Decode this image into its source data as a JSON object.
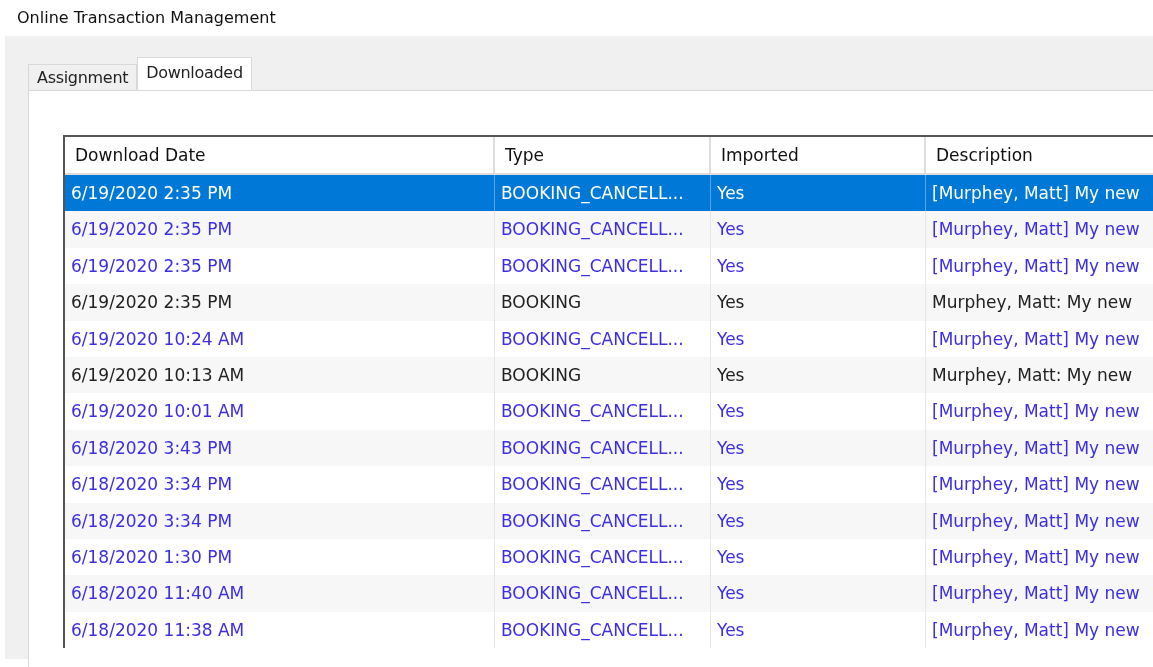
{
  "window": {
    "title": "Online Transaction Management"
  },
  "tabs": [
    {
      "label": "Assignment",
      "selected": false
    },
    {
      "label": "Downloaded",
      "selected": true
    }
  ],
  "table": {
    "columns": [
      "Download Date",
      "Type",
      "Imported",
      "Description"
    ],
    "rows": [
      {
        "kind": "cancellation",
        "selected": true,
        "cells": [
          "6/19/2020 2:35 PM",
          "BOOKING_CANCELL...",
          "Yes",
          "[Murphey, Matt] My new"
        ]
      },
      {
        "kind": "cancellation",
        "selected": false,
        "cells": [
          "6/19/2020 2:35 PM",
          "BOOKING_CANCELL...",
          "Yes",
          "[Murphey, Matt] My new"
        ]
      },
      {
        "kind": "cancellation",
        "selected": false,
        "cells": [
          "6/19/2020 2:35 PM",
          "BOOKING_CANCELL...",
          "Yes",
          "[Murphey, Matt] My new"
        ]
      },
      {
        "kind": "booking",
        "selected": false,
        "cells": [
          "6/19/2020 2:35 PM",
          "BOOKING",
          "Yes",
          "Murphey, Matt: My new"
        ]
      },
      {
        "kind": "cancellation",
        "selected": false,
        "cells": [
          "6/19/2020 10:24 AM",
          "BOOKING_CANCELL...",
          "Yes",
          "[Murphey, Matt] My new"
        ]
      },
      {
        "kind": "booking",
        "selected": false,
        "cells": [
          "6/19/2020 10:13 AM",
          "BOOKING",
          "Yes",
          "Murphey, Matt: My new"
        ]
      },
      {
        "kind": "cancellation",
        "selected": false,
        "cells": [
          "6/19/2020 10:01 AM",
          "BOOKING_CANCELL...",
          "Yes",
          "[Murphey, Matt] My new"
        ]
      },
      {
        "kind": "cancellation",
        "selected": false,
        "cells": [
          "6/18/2020 3:43 PM",
          "BOOKING_CANCELL...",
          "Yes",
          "[Murphey, Matt] My new"
        ]
      },
      {
        "kind": "cancellation",
        "selected": false,
        "cells": [
          "6/18/2020 3:34 PM",
          "BOOKING_CANCELL...",
          "Yes",
          "[Murphey, Matt] My new"
        ]
      },
      {
        "kind": "cancellation",
        "selected": false,
        "cells": [
          "6/18/2020 3:34 PM",
          "BOOKING_CANCELL...",
          "Yes",
          "[Murphey, Matt] My new"
        ]
      },
      {
        "kind": "cancellation",
        "selected": false,
        "cells": [
          "6/18/2020 1:30 PM",
          "BOOKING_CANCELL...",
          "Yes",
          "[Murphey, Matt] My new"
        ]
      },
      {
        "kind": "cancellation",
        "selected": false,
        "cells": [
          "6/18/2020 11:40 AM",
          "BOOKING_CANCELL...",
          "Yes",
          "[Murphey, Matt] My new"
        ]
      },
      {
        "kind": "cancellation",
        "selected": false,
        "cells": [
          "6/18/2020 11:38 AM",
          "BOOKING_CANCELL...",
          "Yes",
          "[Murphey, Matt] My new"
        ]
      }
    ]
  }
}
